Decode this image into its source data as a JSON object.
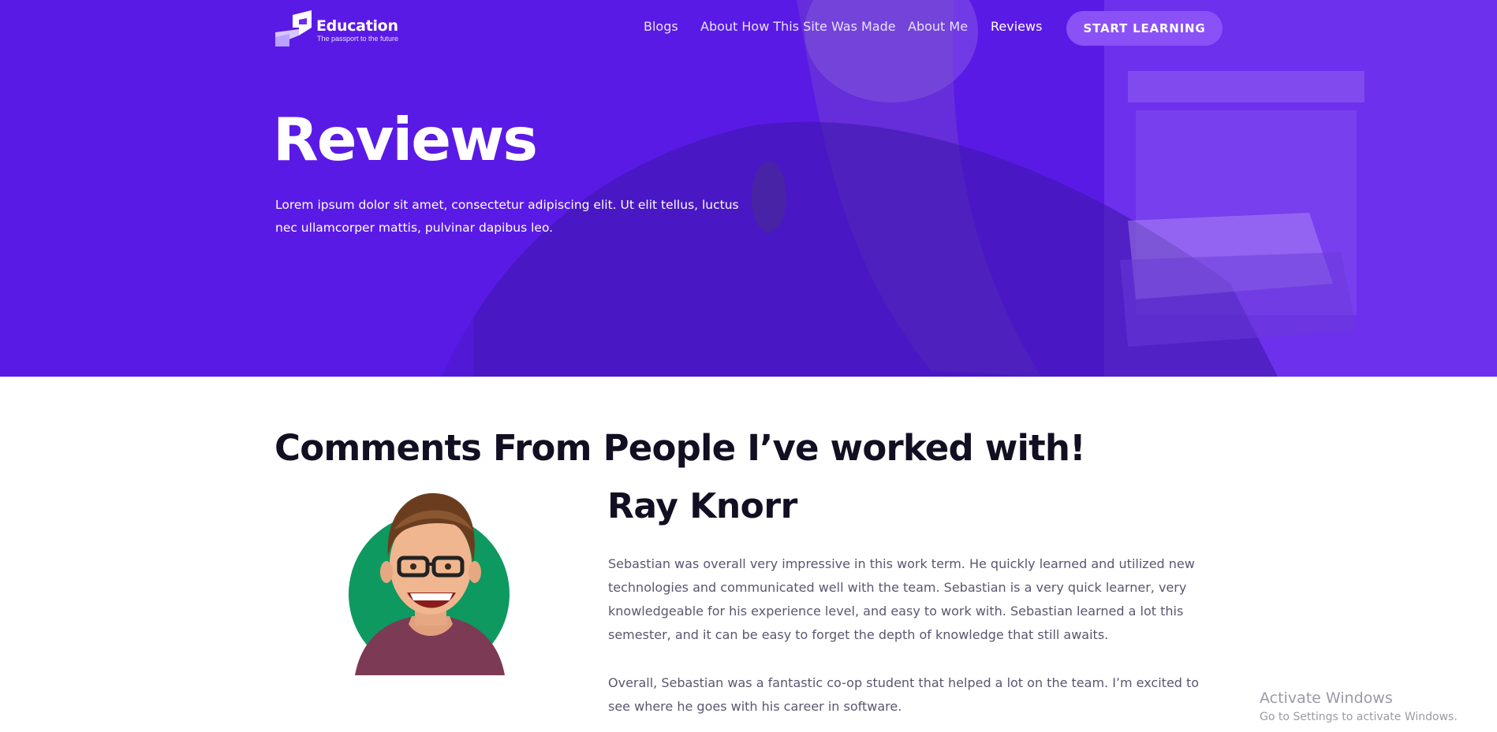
{
  "brand": {
    "name": "Education",
    "tagline": "The passport to the future"
  },
  "nav": {
    "items": [
      {
        "label": "Blogs"
      },
      {
        "label": "About How This Site Was Made"
      },
      {
        "label": "About Me"
      },
      {
        "label": "Reviews",
        "active": true
      }
    ],
    "cta_label": "START LEARNING"
  },
  "hero": {
    "title": "Reviews",
    "subtitle": "Lorem ipsum dolor sit amet, consectetur adipiscing elit. Ut elit tellus, luctus nec ullamcorper mattis, pulvinar dapibus leo."
  },
  "reviews": {
    "heading": "Comments From People I’ve worked with!",
    "items": [
      {
        "name": "Ray Knorr",
        "avatar_icon": "cartoon-man-avatar-icon",
        "paragraphs": [
          "Sebastian was overall very impressive in this work term. He quickly learned and utilized new technologies and communicated well with the team. Sebastian is a very quick learner, very knowledgeable for his experience level, and easy to work with. Sebastian learned a lot this semester, and it can be easy to forget the depth of knowledge that still awaits.",
          "Overall, Sebastian was a fantastic co-op student that helped a lot on the team. I’m excited to see where he goes with his career in software."
        ]
      }
    ]
  },
  "watermark": {
    "title": "Activate Windows",
    "subtitle": "Go to Settings to activate Windows."
  },
  "colors": {
    "hero_purple": "#5a1ae6",
    "cta_purple": "#8a52f6",
    "heading_dark": "#130f22",
    "body_text": "#5b5670",
    "avatar_green": "#0e9960"
  }
}
